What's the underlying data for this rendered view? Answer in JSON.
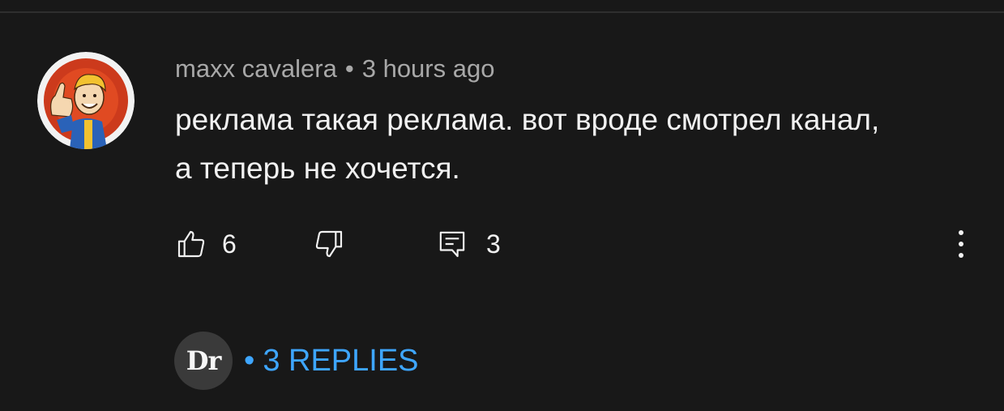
{
  "comment": {
    "author": "maxx cavalera",
    "separator": "•",
    "time": "3 hours ago",
    "text": "реклама такая реклама. вот вроде смотрел канал, а теперь не хочется.",
    "like_count": "6",
    "reply_count": "3"
  },
  "replies": {
    "avatar_text": "Dr",
    "separator": "•",
    "label": "3 REPLIES"
  },
  "icons": {
    "like": "thumbs-up-icon",
    "dislike": "thumbs-down-icon",
    "reply": "comment-icon",
    "more": "more-vert-icon"
  },
  "colors": {
    "background": "#181818",
    "text_primary": "#f1f1f1",
    "text_secondary": "#a8a8a8",
    "link": "#3ea6ff"
  }
}
